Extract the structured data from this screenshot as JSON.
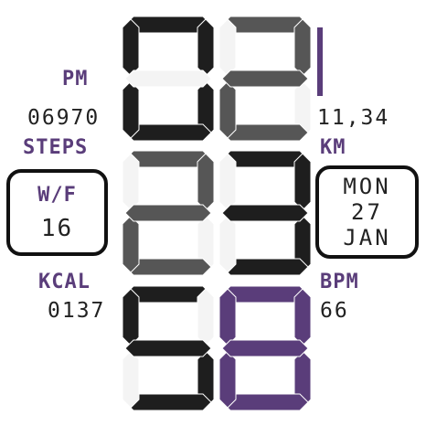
{
  "time": {
    "hour": "02",
    "minute": "23",
    "second": "58",
    "am_pm": "PM"
  },
  "steps": {
    "value": "06970",
    "label": "STEPS"
  },
  "distance": {
    "value": "11,34",
    "label": "KM"
  },
  "week": {
    "label": "W/F",
    "value": "16"
  },
  "date": {
    "day_name": "MON",
    "day": "27",
    "month": "JAN"
  },
  "calories": {
    "label": "KCAL",
    "value": "0137"
  },
  "heart_rate": {
    "label": "BPM",
    "value": "66"
  },
  "battery_level_pct": 100,
  "colors": {
    "accent": "#5a3d7a",
    "digit_dark": "#1e1e1e",
    "digit_gray": "#565656",
    "digit_purple": "#5a3d7a",
    "text": "#222222"
  }
}
